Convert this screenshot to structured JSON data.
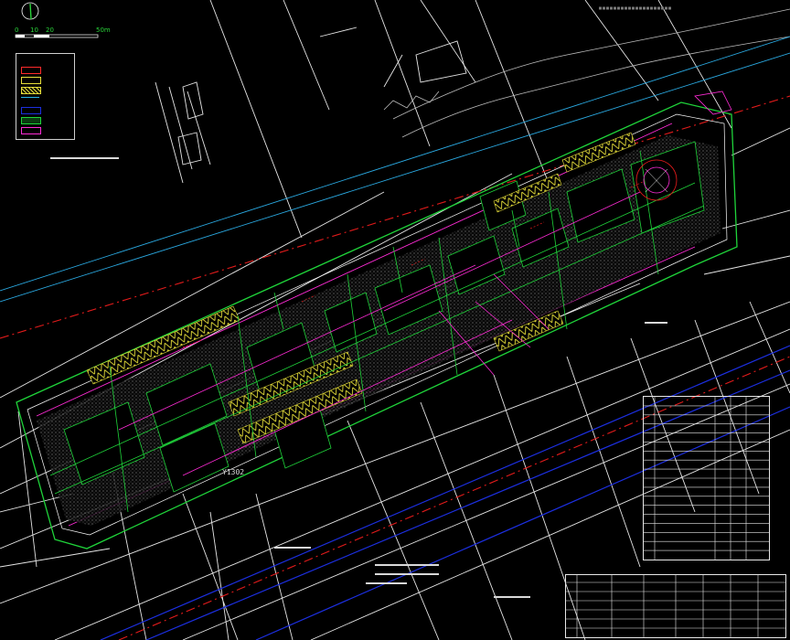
{
  "scale_bar": {
    "ticks": [
      "0",
      "10",
      "20",
      "50m"
    ]
  },
  "labels": {
    "site_code": "Y1302"
  },
  "colors": {
    "background": "#000000",
    "grid": "#e0e0e0",
    "road_red": "#e31b1b",
    "road_blue": "#1c2fe0",
    "cyan_line": "#28b4e6",
    "green": "#1fd43a",
    "magenta": "#ff2bd6",
    "yellow": "#e7df3a",
    "white": "#ffffff"
  },
  "icons": {
    "north_arrow": "north-arrow-icon"
  }
}
